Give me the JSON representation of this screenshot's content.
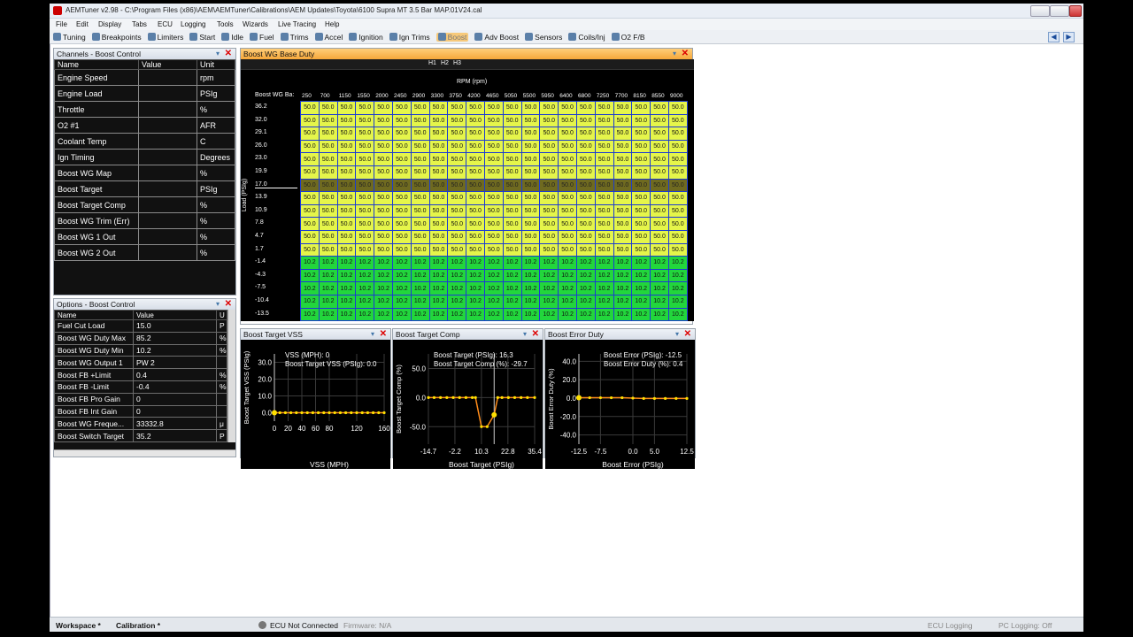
{
  "window": {
    "title": "AEMTuner v2.98 - C:\\Program Files (x86)\\AEM\\AEMTuner\\Calibrations\\AEM Updates\\Toyota\\6100 Supra MT 3.5 Bar MAP.01V24.cal"
  },
  "menu": [
    "File",
    "Edit",
    "Display",
    "Tabs",
    "ECU",
    "Logging",
    "Tools",
    "Wizards",
    "Live Tracing",
    "Help"
  ],
  "toolbar": [
    {
      "label": "Tuning",
      "icon": "tuning-icon"
    },
    {
      "label": "Breakpoints",
      "icon": "breakpoints-icon"
    },
    {
      "label": "Limiters",
      "icon": "limiters-icon"
    },
    {
      "label": "Start",
      "icon": "start-icon"
    },
    {
      "label": "Idle",
      "icon": "idle-icon"
    },
    {
      "label": "Fuel",
      "icon": "fuel-icon"
    },
    {
      "label": "Trims",
      "icon": "trims-icon"
    },
    {
      "label": "Accel",
      "icon": "accel-icon"
    },
    {
      "label": "Ignition",
      "icon": "ignition-icon"
    },
    {
      "label": "Ign Trims",
      "icon": "ign-trims-icon"
    },
    {
      "label": "Boost",
      "icon": "boost-icon",
      "active": true
    },
    {
      "label": "Adv Boost",
      "icon": "adv-boost-icon"
    },
    {
      "label": "Sensors",
      "icon": "sensors-icon"
    },
    {
      "label": "Coils/Inj",
      "icon": "coils-icon"
    },
    {
      "label": "O2 F/B",
      "icon": "o2-icon"
    }
  ],
  "channels": {
    "title": "Channels - Boost Control",
    "headers": [
      "Name",
      "Value",
      "Unit"
    ],
    "rows": [
      [
        "Engine Speed",
        "",
        "rpm"
      ],
      [
        "Engine Load",
        "",
        "PSIg"
      ],
      [
        "Throttle",
        "",
        "%"
      ],
      [
        "O2 #1",
        "",
        "AFR"
      ],
      [
        "Coolant Temp",
        "",
        "C"
      ],
      [
        "Ign Timing",
        "",
        "Degrees"
      ],
      [
        "Boost WG Map",
        "",
        "%"
      ],
      [
        "Boost Target",
        "",
        "PSIg"
      ],
      [
        "Boost Target Comp",
        "",
        "%"
      ],
      [
        "Boost WG Trim (Err)",
        "",
        "%"
      ],
      [
        "Boost WG 1 Out",
        "",
        "%"
      ],
      [
        "Boost WG 2 Out",
        "",
        "%"
      ]
    ]
  },
  "options": {
    "title": "Options - Boost Control",
    "headers": [
      "Name",
      "Value",
      "U"
    ],
    "rows": [
      [
        "Fuel Cut Load",
        "15.0",
        "P"
      ],
      [
        "Boost WG Duty Max",
        "85.2",
        "%"
      ],
      [
        "Boost WG Duty Min",
        "10.2",
        "%"
      ],
      [
        "Boost WG Output 1",
        "PW 2",
        ""
      ],
      [
        "Boost FB +Limit",
        "0.4",
        "%"
      ],
      [
        "Boost FB -Limit",
        "-0.4",
        "%"
      ],
      [
        "Boost FB Pro Gain",
        "0",
        ""
      ],
      [
        "Boost FB Int Gain",
        "0",
        ""
      ],
      [
        "Boost WG Freque...",
        "33332.8",
        "μ"
      ],
      [
        "Boost Switch Target",
        "35.2",
        "P"
      ]
    ]
  },
  "map": {
    "title": "Boost WG Base Duty",
    "corner": "Boost WG Ba:",
    "xaxis": "RPM (rpm)",
    "yaxis": "Load (PSIg)",
    "h1": "H1",
    "h2": "H2",
    "h3": "H3",
    "rpm": [
      "250",
      "700",
      "1150",
      "1550",
      "2000",
      "2450",
      "2900",
      "3300",
      "3750",
      "4200",
      "4650",
      "5050",
      "5500",
      "5950",
      "6400",
      "6800",
      "7250",
      "7700",
      "8150",
      "8550",
      "9000"
    ],
    "load": [
      "36.2",
      "32.0",
      "29.1",
      "26.0",
      "23.0",
      "19.9",
      "17.0",
      "13.9",
      "10.9",
      "7.8",
      "4.7",
      "1.7",
      "-1.4",
      "-4.3",
      "-7.5",
      "-10.4",
      "-13.5"
    ],
    "high": "50.0",
    "low": "10.2",
    "highRows": 12,
    "selectedRow": 6
  },
  "plots": [
    {
      "title": "Boost Target VSS",
      "xlabel": "VSS (MPH)",
      "ylabel": "Boost Target VSS (PSIg)",
      "ro1": "VSS (MPH): 0",
      "ro2": "Boost Target VSS (PSIg): 0.0",
      "xticks": [
        "0",
        "20",
        "40",
        "60",
        "80",
        "120",
        "160"
      ],
      "yticks": [
        "30.0",
        "20.0",
        "10.0",
        "0.0"
      ]
    },
    {
      "title": "Boost Target Comp",
      "xlabel": "Boost Target (PSIg)",
      "ylabel": "Boost Target Comp (%)",
      "ro1": "Boost Target (PSIg): 16.3",
      "ro2": "Boost Target Comp (%): -29.7",
      "xticks": [
        "-14.7",
        "-2.2",
        "10.3",
        "22.8",
        "35.4"
      ],
      "yticks": [
        "50.0",
        "0.0",
        "-50.0"
      ]
    },
    {
      "title": "Boost Error Duty",
      "xlabel": "Boost Error (PSIg)",
      "ylabel": "Boost Error Duty (%)",
      "ro1": "Boost Error (PSIg): -12.5",
      "ro2": "Boost Error Duty (%): 0.4",
      "xticks": [
        "-12.5",
        "-7.5",
        "0.0",
        "5.0",
        "12.5"
      ],
      "yticks": [
        "40.0",
        "20.0",
        "0.0",
        "-20.0",
        "-40.0"
      ]
    }
  ],
  "status": {
    "workspace": "Workspace *",
    "calibration": "Calibration *",
    "ecu": "ECU Not Connected",
    "firmware": "Firmware: N/A",
    "ecu_logging": "ECU Logging",
    "pc_logging": "PC Logging: Off"
  }
}
